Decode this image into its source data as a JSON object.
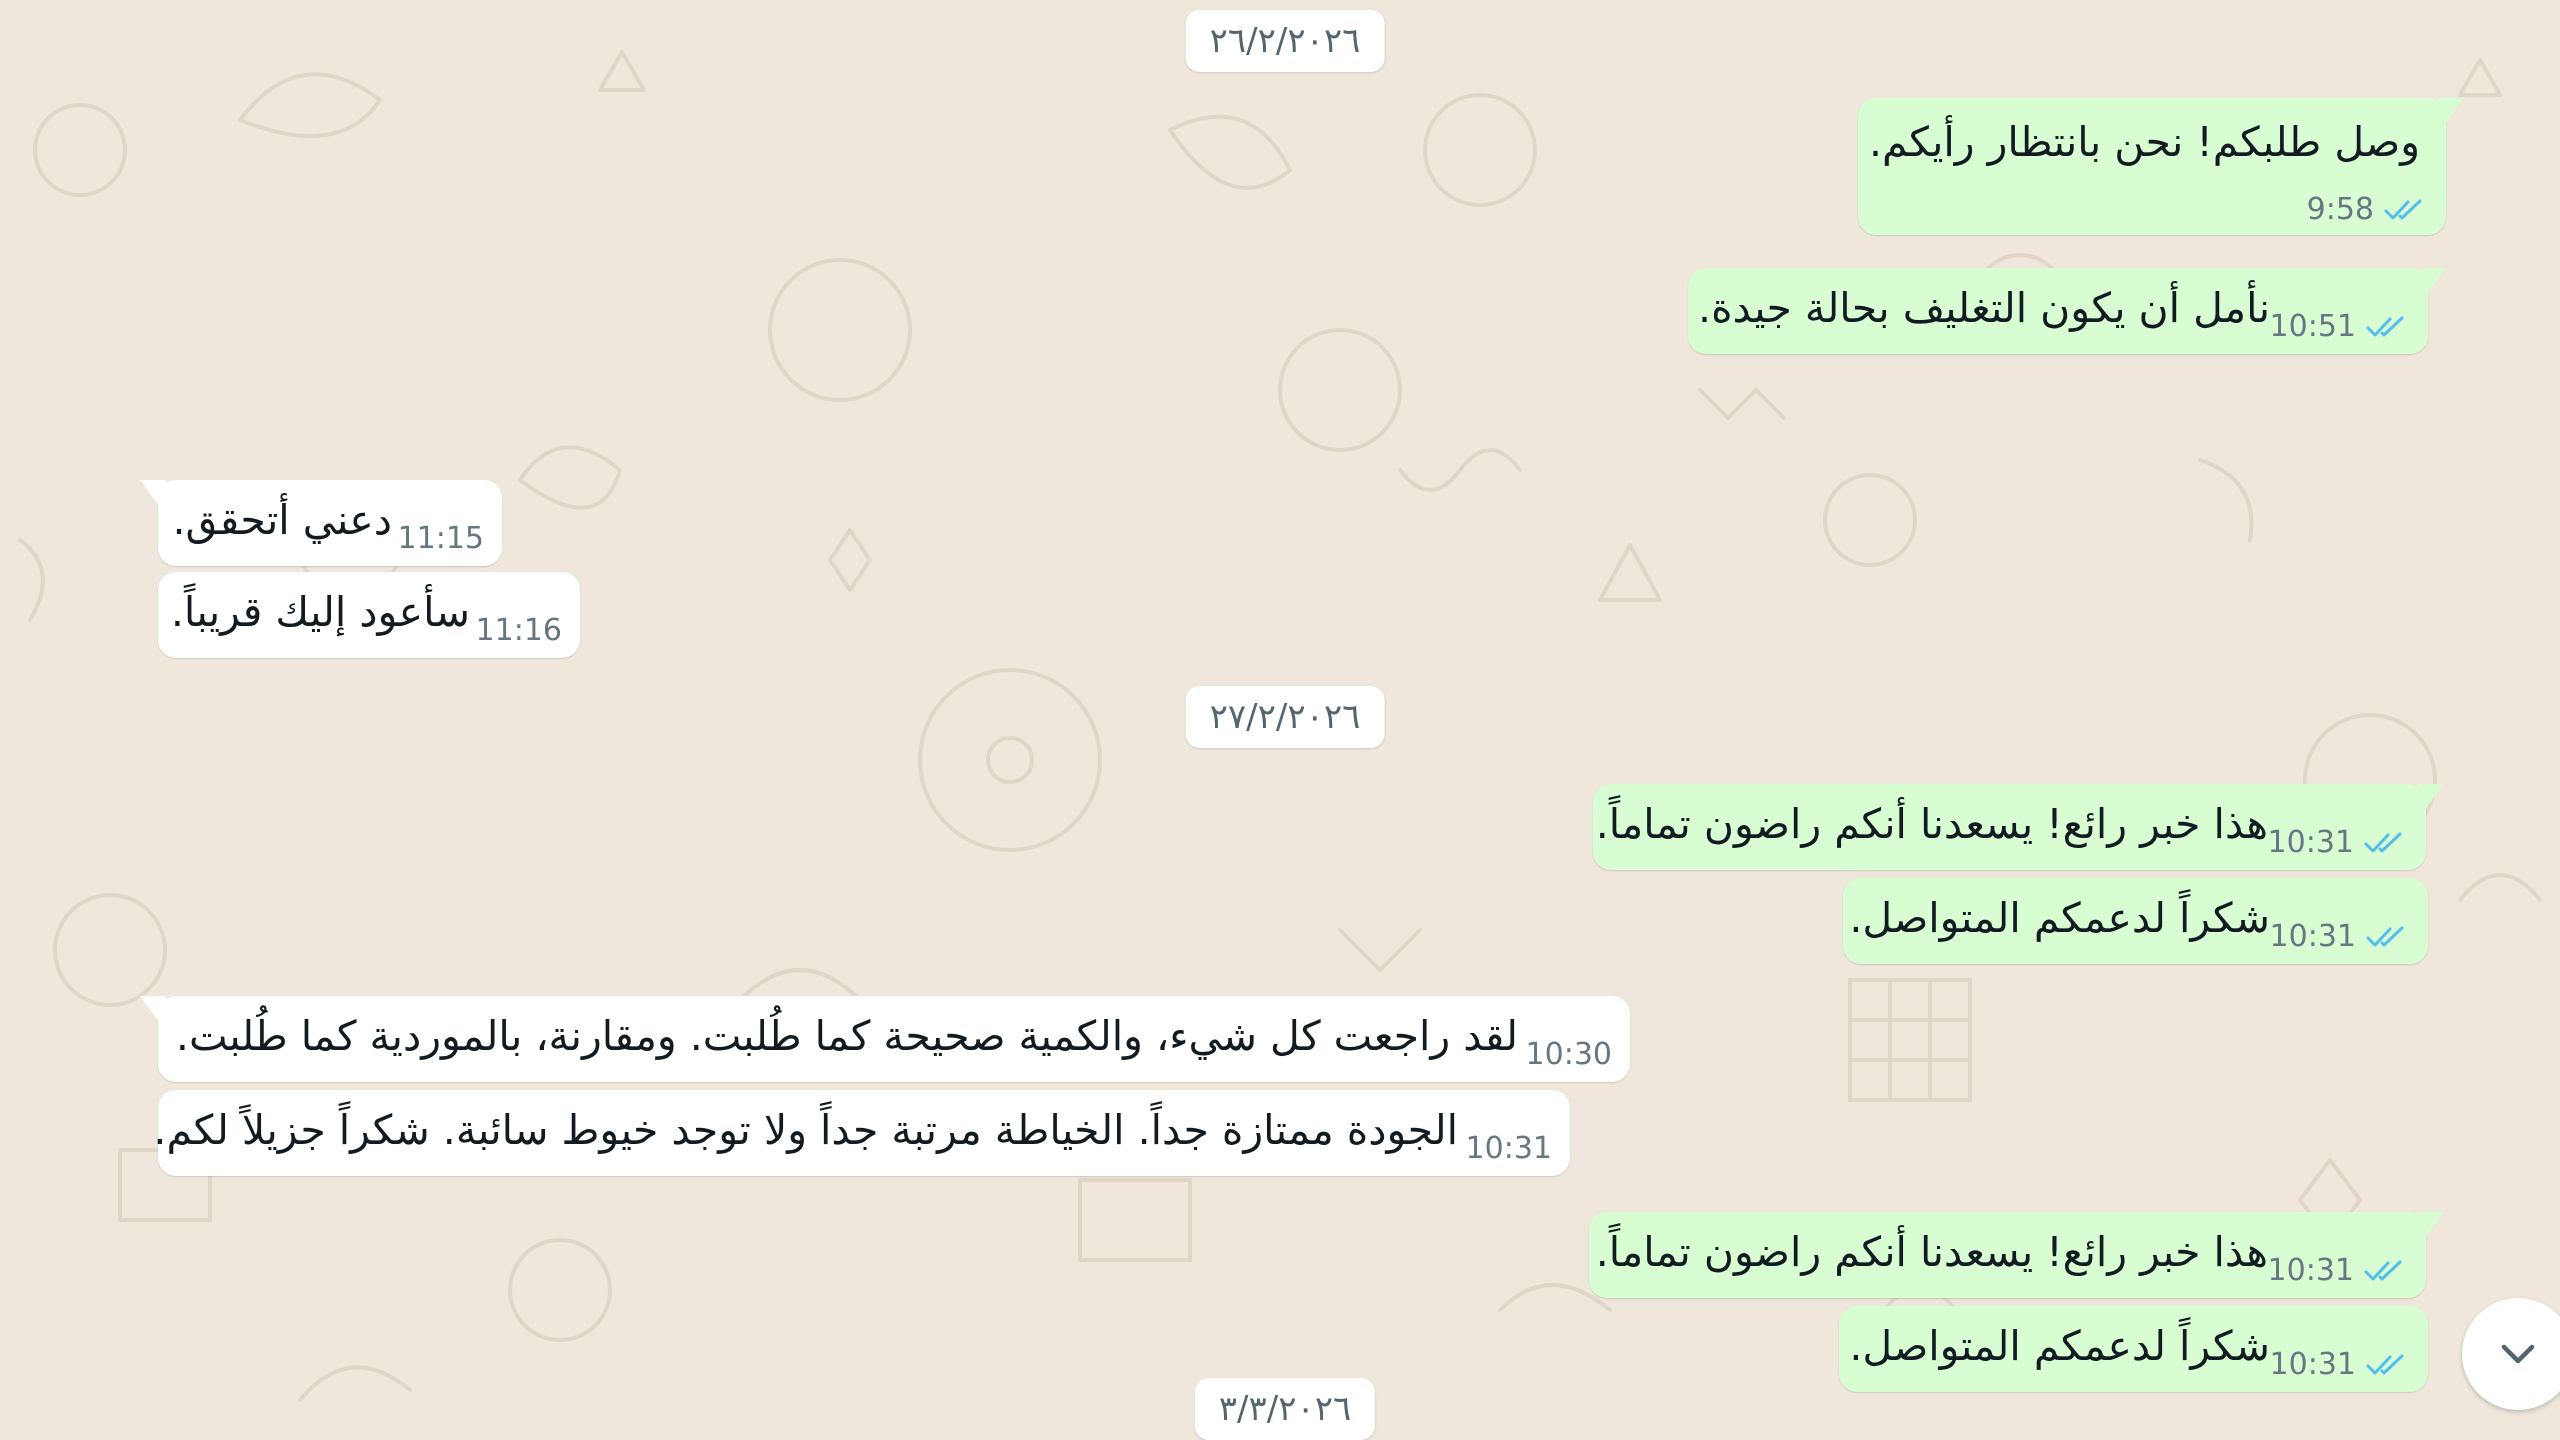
{
  "colors": {
    "background": "#efe7dc",
    "outgoing_bubble": "#d9fdd3",
    "incoming_bubble": "#ffffff",
    "tick_read": "#53bdeb",
    "meta_text": "#667781"
  },
  "chat": {
    "date_separators": [
      "٢٦/٢/٢٠٢٦",
      "٢٧/٢/٢٠٢٦",
      "٣/٣/٢٠٢٦"
    ],
    "messages": [
      {
        "direction": "out",
        "text": "وصل طلبكم! نحن بانتظار رأيكم.",
        "time": "9:58",
        "status": "read"
      },
      {
        "direction": "out",
        "text": "نأمل أن يكون التغليف بحالة جيدة.",
        "time": "10:51",
        "status": "read"
      },
      {
        "direction": "in",
        "text": "دعني أتحقق.",
        "time": "11:15"
      },
      {
        "direction": "in",
        "text": "سأعود إليك قريباً.",
        "time": "11:16"
      },
      {
        "direction": "out",
        "text": "هذا خبر رائع! يسعدنا أنكم راضون تماماً.",
        "time": "10:31",
        "status": "read"
      },
      {
        "direction": "out",
        "text": "شكراً لدعمكم المتواصل.",
        "time": "10:31",
        "status": "read"
      },
      {
        "direction": "in",
        "text": "لقد راجعت كل شيء، والكمية صحيحة كما طُلبت. ومقارنة، بالموردية كما طُلبت.",
        "time": "10:30"
      },
      {
        "direction": "in",
        "text": "الجودة ممتازة جداً. الخياطة مرتبة جداً ولا توجد خيوط سائبة. شكراً جزيلاً لكم.",
        "time": "10:31"
      },
      {
        "direction": "out",
        "text": "هذا خبر رائع! يسعدنا أنكم راضون تماماً.",
        "time": "10:31",
        "status": "read"
      },
      {
        "direction": "out",
        "text": "شكراً لدعمكم المتواصل.",
        "time": "10:31",
        "status": "read"
      }
    ]
  },
  "scroll_button": {
    "icon": "chevron-down-icon"
  }
}
